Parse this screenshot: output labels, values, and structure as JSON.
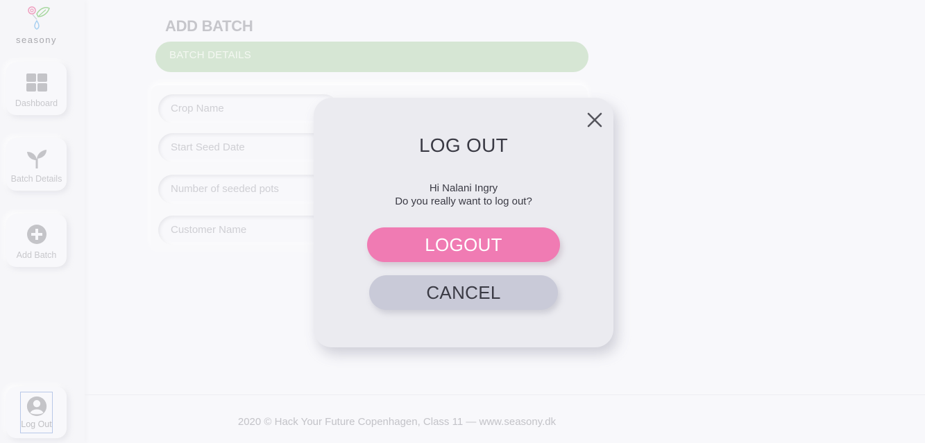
{
  "app": {
    "logo_text": "seasony"
  },
  "sidebar": {
    "items": [
      {
        "label": "Dashboard",
        "icon": "dashboard-grid-icon"
      },
      {
        "label": "Batch Details",
        "icon": "sprout-icon"
      },
      {
        "label": "Add Batch",
        "icon": "plus-circle-icon"
      }
    ],
    "logout": {
      "label": "Log Out",
      "icon": "user-avatar-icon"
    }
  },
  "main": {
    "title": "ADD BATCH",
    "section": "BATCH DETAILS",
    "fields": [
      {
        "placeholder": "Crop Name"
      },
      {
        "placeholder": "Start Seed Date"
      },
      {
        "placeholder": "Number of seeded pots"
      },
      {
        "placeholder": "Customer Name"
      }
    ]
  },
  "footer": {
    "text": "2020 © Hack Your Future Copenhagen, Class 11 — www.seasony.dk"
  },
  "modal": {
    "title": "LOG OUT",
    "greeting": "Hi Nalani Ingry",
    "question": "Do you really want to log out?",
    "confirm_label": "LOGOUT",
    "cancel_label": "CANCEL"
  },
  "colors": {
    "accent_pink": "#f07bb3",
    "section_green": "#d6e6d4",
    "cancel_gray": "#c9cad8"
  }
}
